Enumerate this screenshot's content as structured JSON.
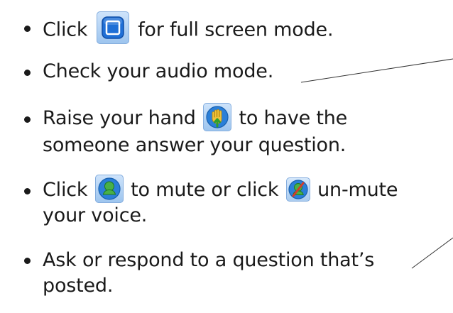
{
  "items": [
    {
      "pre": "Click",
      "icon": "full-screen-icon",
      "post": "for full screen mode."
    },
    {
      "text": "Check your audio mode."
    },
    {
      "pre": "Raise your hand",
      "icon": "raise-hand-icon",
      "post": "to have the",
      "line2": "someone answer your question."
    },
    {
      "pre": "Click",
      "icon": "microphone-icon",
      "mid": "to mute or click",
      "icon2": "muted-microphone-icon",
      "post": "un-mute",
      "line2": "your voice."
    },
    {
      "text": "Ask or respond to a question that’s",
      "line2": "posted."
    }
  ],
  "colors": {
    "text": "#1a1a1a",
    "icon_bg_top": "#cfe4fb",
    "icon_bg_bottom": "#9cc4ee",
    "full_screen_blue": "#1f6fd6",
    "hand_green": "#2f9e2f",
    "hand_gold": "#f0c23a",
    "mic_green": "#49b049",
    "mute_red": "#d33c2a"
  }
}
